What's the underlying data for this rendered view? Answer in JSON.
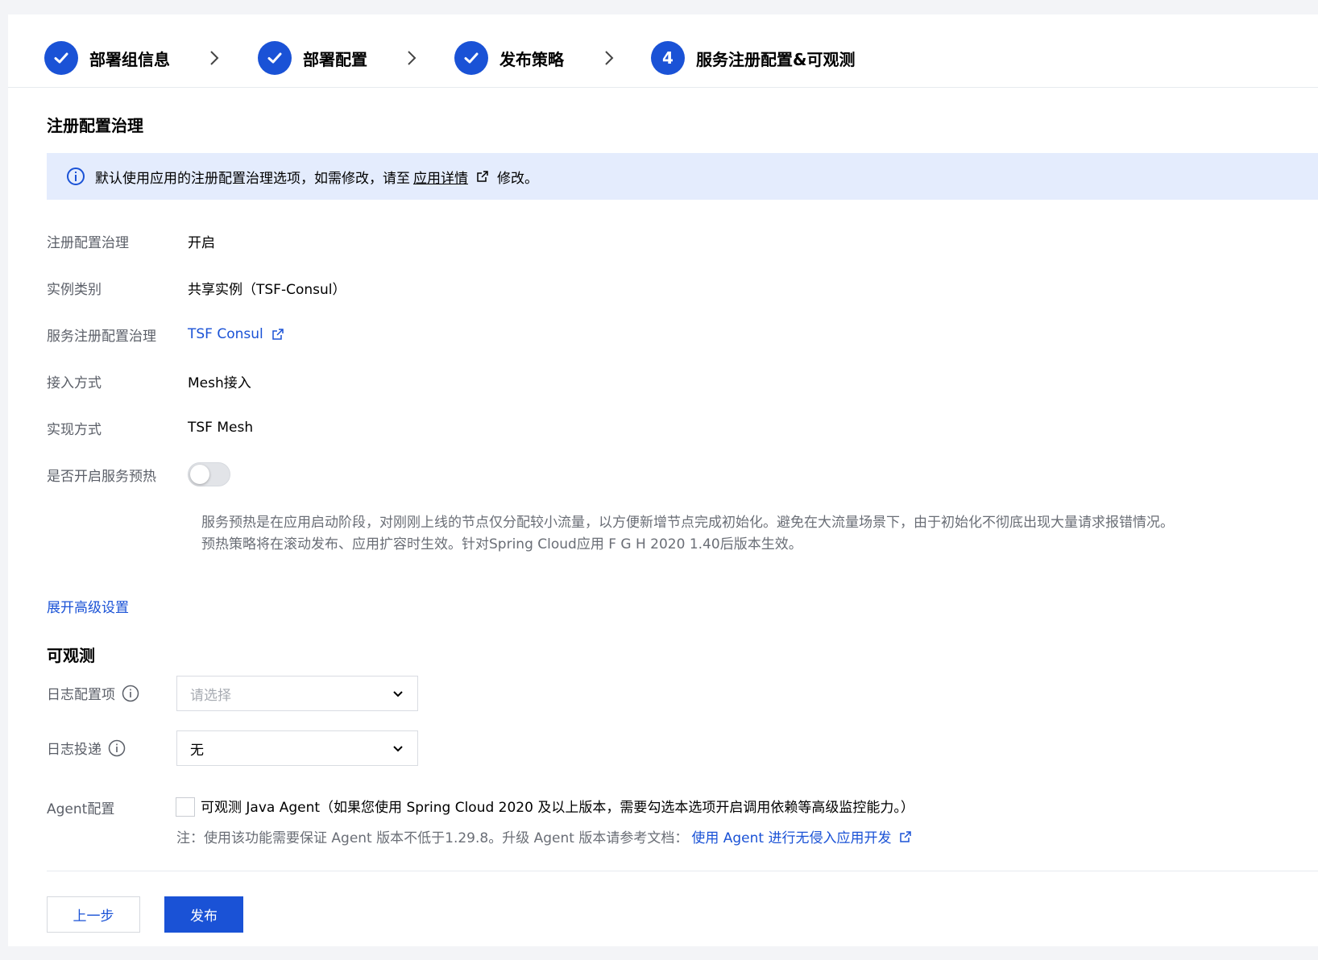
{
  "steps": [
    {
      "label": "部署组信息",
      "status": "done"
    },
    {
      "label": "部署配置",
      "status": "done"
    },
    {
      "label": "发布策略",
      "status": "done"
    },
    {
      "label": "服务注册配置&可观测",
      "status": "current",
      "number": "4"
    }
  ],
  "registry": {
    "title": "注册配置治理",
    "notice": {
      "prefix": "默认使用应用的注册配置治理选项，如需修改，请至",
      "link": "应用详情",
      "suffix": "修改。"
    },
    "fields": [
      {
        "label": "注册配置治理",
        "value": "开启"
      },
      {
        "label": "实例类别",
        "value": "共享实例（TSF-Consul）"
      },
      {
        "label": "服务注册配置治理",
        "value": "TSF Consul"
      },
      {
        "label": "接入方式",
        "value": "Mesh接入"
      },
      {
        "label": "实现方式",
        "value": "TSF Mesh"
      }
    ],
    "warmup": {
      "label": "是否开启服务预热",
      "enabled": false,
      "desc_line1": "服务预热是在应用启动阶段，对刚刚上线的节点仅分配较小流量，以方便新增节点完成初始化。避免在大流量场景下，由于初始化不彻底出现大量请求报错情况。",
      "desc_line2": "预热策略将在滚动发布、应用扩容时生效。针对Spring Cloud应用 F G H 2020 1.40后版本生效。"
    },
    "expand_link": "展开高级设置"
  },
  "observability": {
    "title": "可观测",
    "log_config": {
      "label": "日志配置项",
      "placeholder": "请选择"
    },
    "log_delivery": {
      "label": "日志投递",
      "value": "无"
    },
    "agent": {
      "label": "Agent配置",
      "checked": false,
      "checkbox_text": "可观测 Java Agent（如果您使用 Spring Cloud 2020 及以上版本，需要勾选本选项开启调用依赖等高级监控能力。）",
      "note_prefix": "注：使用该功能需要保证 Agent 版本不低于1.29.8。升级 Agent 版本请参考文档：",
      "note_link": "使用 Agent 进行无侵入应用开发"
    }
  },
  "buttons": {
    "prev": "上一步",
    "publish": "发布"
  },
  "colors": {
    "primary": "#1a52d6",
    "notice_bg": "#e4ecfd"
  }
}
